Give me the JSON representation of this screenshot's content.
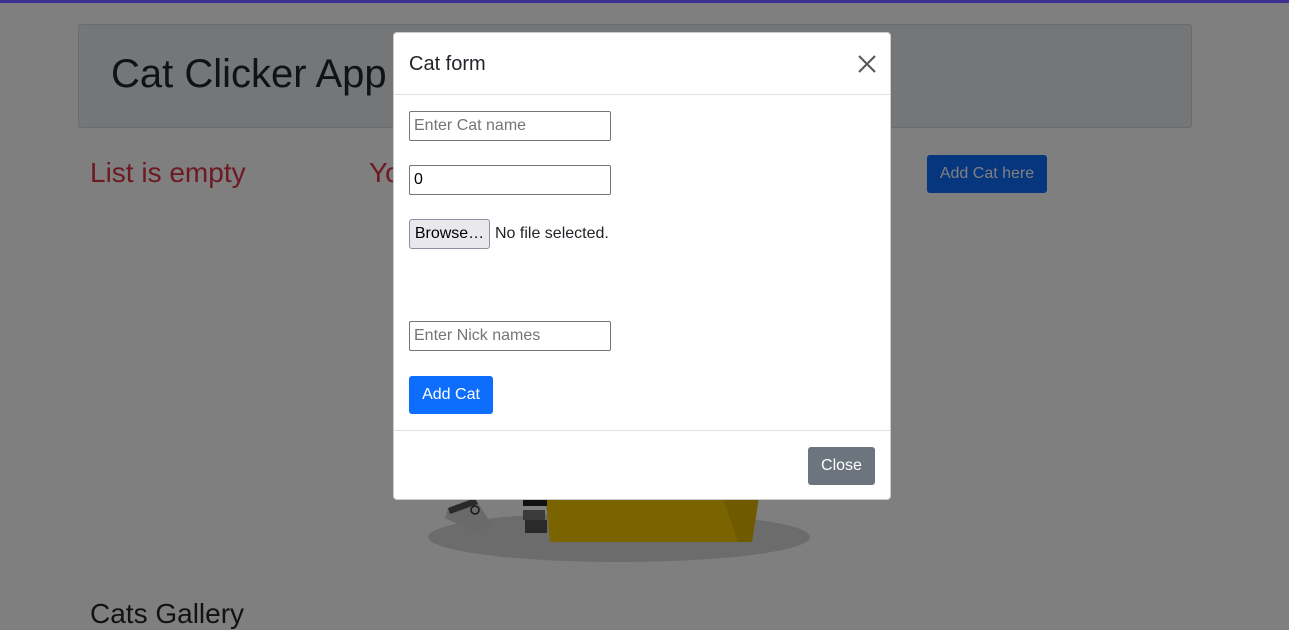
{
  "page": {
    "app_title": "Cat Clicker App",
    "list_status": "List is empty",
    "partial_text": "Yo",
    "add_cat_here_label": "Add Cat here",
    "gallery_title": "Cats Gallery"
  },
  "modal": {
    "title": "Cat form",
    "close_icon": "close-x-icon",
    "cat_name_placeholder": "Enter Cat name",
    "clicks_value": "0",
    "browse_label": "Browse…",
    "file_status": "No file selected.",
    "nick_names_placeholder": "Enter Nick names",
    "add_cat_label": "Add Cat",
    "close_label": "Close"
  },
  "colors": {
    "primary": "#0d6efd",
    "secondary": "#6c757d",
    "danger": "#dc3545",
    "top_bar": "#3b2f8f"
  }
}
